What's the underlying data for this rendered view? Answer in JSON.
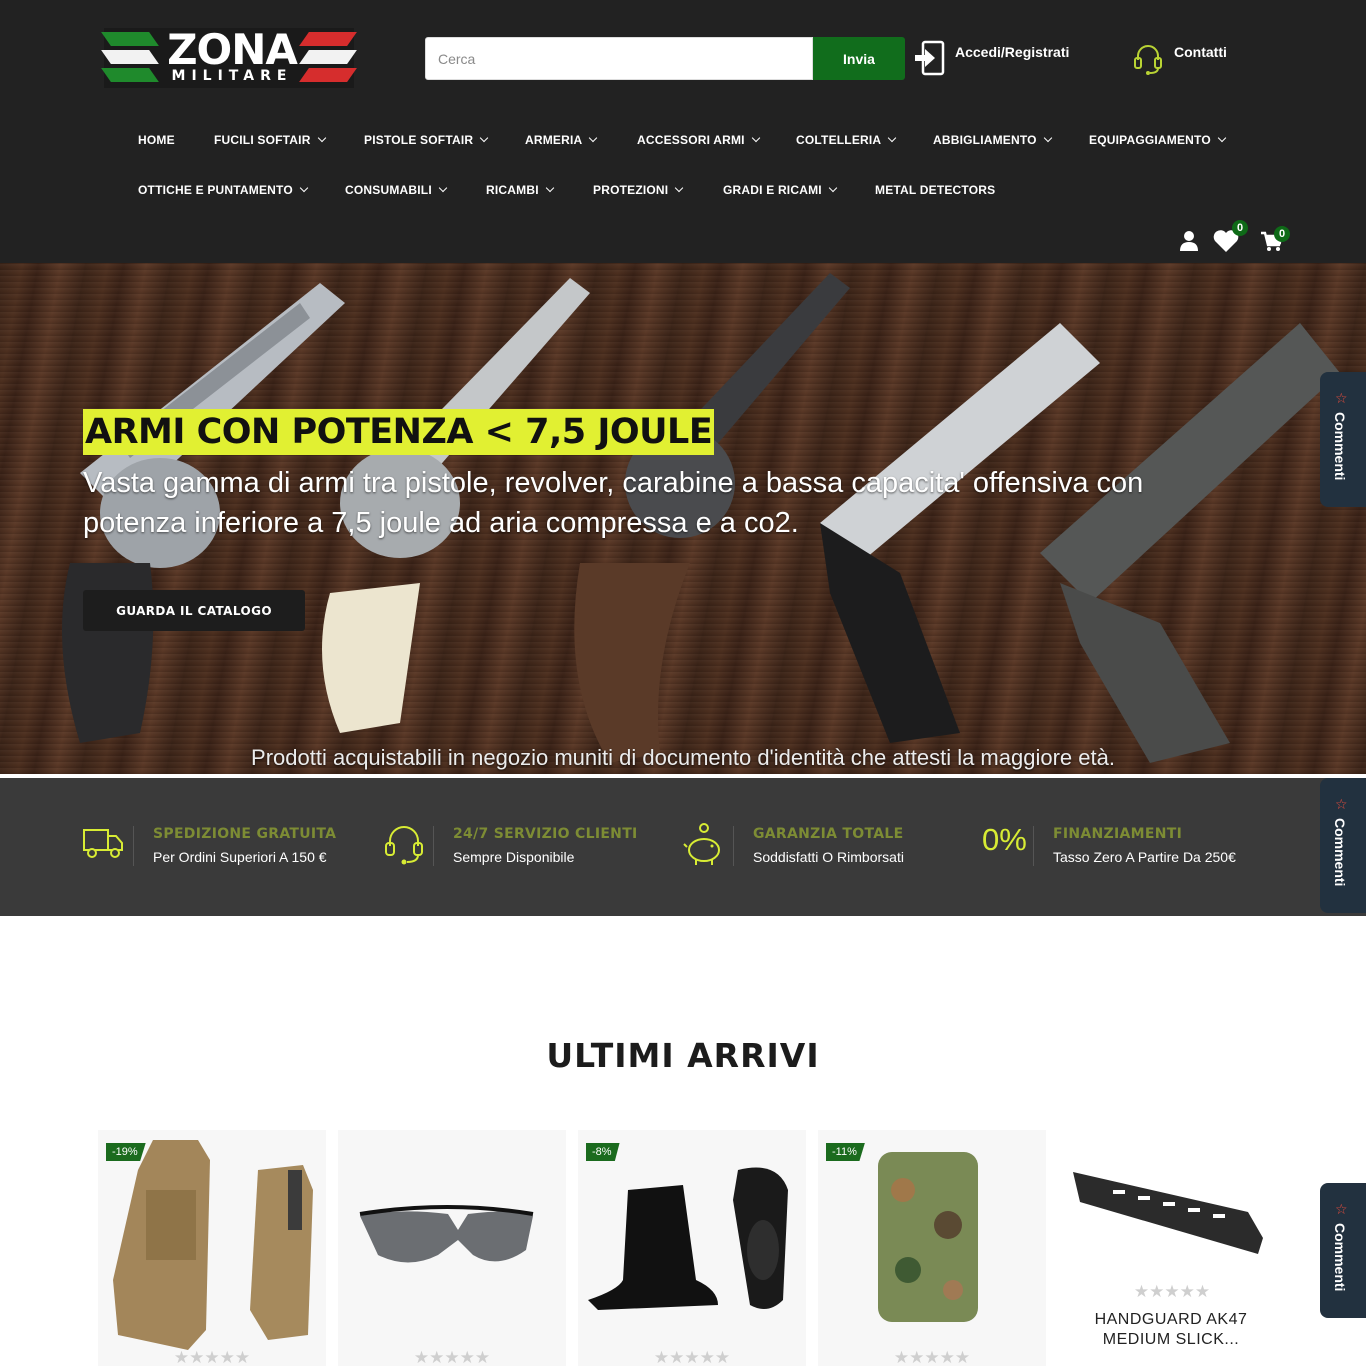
{
  "header": {
    "logo": {
      "line1": "ZONA",
      "line2": "MILITARE"
    },
    "search": {
      "placeholder": "Cerca",
      "button_label": "Invia"
    },
    "account_label": "Accedi/Registrati",
    "contact_label": "Contatti",
    "wishlist_count": "0",
    "cart_count": "0"
  },
  "nav": {
    "row1": [
      {
        "label": "HOME",
        "has_dropdown": false
      },
      {
        "label": "FUCILI SOFTAIR",
        "has_dropdown": true
      },
      {
        "label": "PISTOLE SOFTAIR",
        "has_dropdown": true
      },
      {
        "label": "ARMERIA",
        "has_dropdown": true
      },
      {
        "label": "ACCESSORI ARMI",
        "has_dropdown": true
      },
      {
        "label": "COLTELLERIA",
        "has_dropdown": true
      },
      {
        "label": "ABBIGLIAMENTO",
        "has_dropdown": true
      },
      {
        "label": "EQUIPAGGIAMENTO",
        "has_dropdown": true
      }
    ],
    "row2": [
      {
        "label": "OTTICHE E PUNTAMENTO",
        "has_dropdown": true
      },
      {
        "label": "CONSUMABILI",
        "has_dropdown": true
      },
      {
        "label": "RICAMBI",
        "has_dropdown": true
      },
      {
        "label": "PROTEZIONI",
        "has_dropdown": true
      },
      {
        "label": "GRADI E RICAMI",
        "has_dropdown": true
      },
      {
        "label": "METAL DETECTORS",
        "has_dropdown": false
      }
    ]
  },
  "hero": {
    "title": "ARMI CON POTENZA < 7,5 JOULE",
    "text": "Vasta gamma di armi tra pistole, revolver, carabine a bassa capacita' offensiva con potenza inferiore a 7,5 joule ad aria compressa e a co2.",
    "button_label": "GUARDA IL CATALOGO",
    "note": "Prodotti acquistabili in negozio muniti di documento d'identità  che attesti la maggiore età."
  },
  "features": [
    {
      "icon": "truck-icon",
      "title": "SPEDIZIONE GRATUITA",
      "subtitle": "Per Ordini Superiori A 150 €"
    },
    {
      "icon": "headset-icon",
      "title": "24/7 SERVIZIO CLIENTI",
      "subtitle": "Sempre Disponibile"
    },
    {
      "icon": "piggy-bank-icon",
      "title": "GARANZIA TOTALE",
      "subtitle": "Soddisfatti O Rimborsati"
    },
    {
      "icon": "percent-icon",
      "icon_text": "0%",
      "title": "FINANZIAMENTI",
      "subtitle": "Tasso Zero A Partire Da 250€"
    }
  ],
  "comment_tab_label": "Commenti",
  "latest": {
    "title": "ULTIMI ARRIVI",
    "products": [
      {
        "image": "pouch-coyote",
        "discount": "-19%",
        "rating": 0,
        "name": ""
      },
      {
        "image": "shooting-glasses",
        "discount": "",
        "rating": 0,
        "name": ""
      },
      {
        "image": "black-boots",
        "discount": "-8%",
        "rating": 0,
        "name": ""
      },
      {
        "image": "camo-pouch",
        "discount": "-11%",
        "rating": 0,
        "name": ""
      },
      {
        "image": "handguard-rail",
        "discount": "",
        "rating": 0,
        "name": "HANDGUARD AK47 MEDIUM SLICK..."
      }
    ]
  },
  "colors": {
    "header_bg": "#222222",
    "accent_green": "#116d1c",
    "highlight_yellow": "#e1f032",
    "features_bg": "#3a3a3a",
    "feature_title": "#7d8c34",
    "comment_tab": "#22313f"
  }
}
